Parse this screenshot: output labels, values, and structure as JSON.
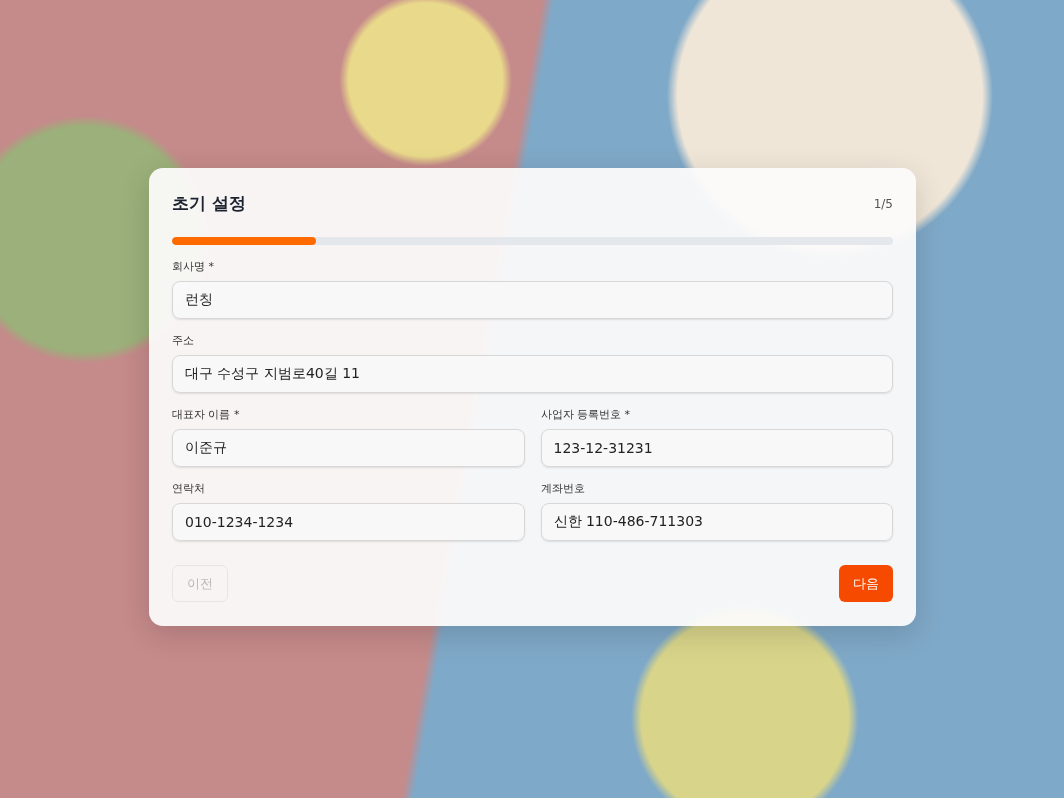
{
  "dialog": {
    "title": "초기 설정",
    "step": "1/5",
    "progress": {
      "level": 0.2
    },
    "rows": [
      [
        {
          "label": "회사명 *",
          "value": "런칭"
        }
      ],
      [
        {
          "label": "주소",
          "value": "대구 수성구 지범로40길 11"
        }
      ],
      [
        {
          "label": "대표자 이름 *",
          "value": "이준규"
        },
        {
          "label": "사업자 등록번호 *",
          "value": "123-12-31231"
        }
      ],
      [
        {
          "label": "연락처",
          "value": "010-1234-1234"
        },
        {
          "label": "계좌번호",
          "value": "신한 110-486-711303"
        }
      ]
    ],
    "buttons": [
      {
        "label": "이전",
        "kind": "secondary",
        "disabled": true
      },
      {
        "label": "다음",
        "kind": "primary",
        "disabled": false
      }
    ]
  }
}
